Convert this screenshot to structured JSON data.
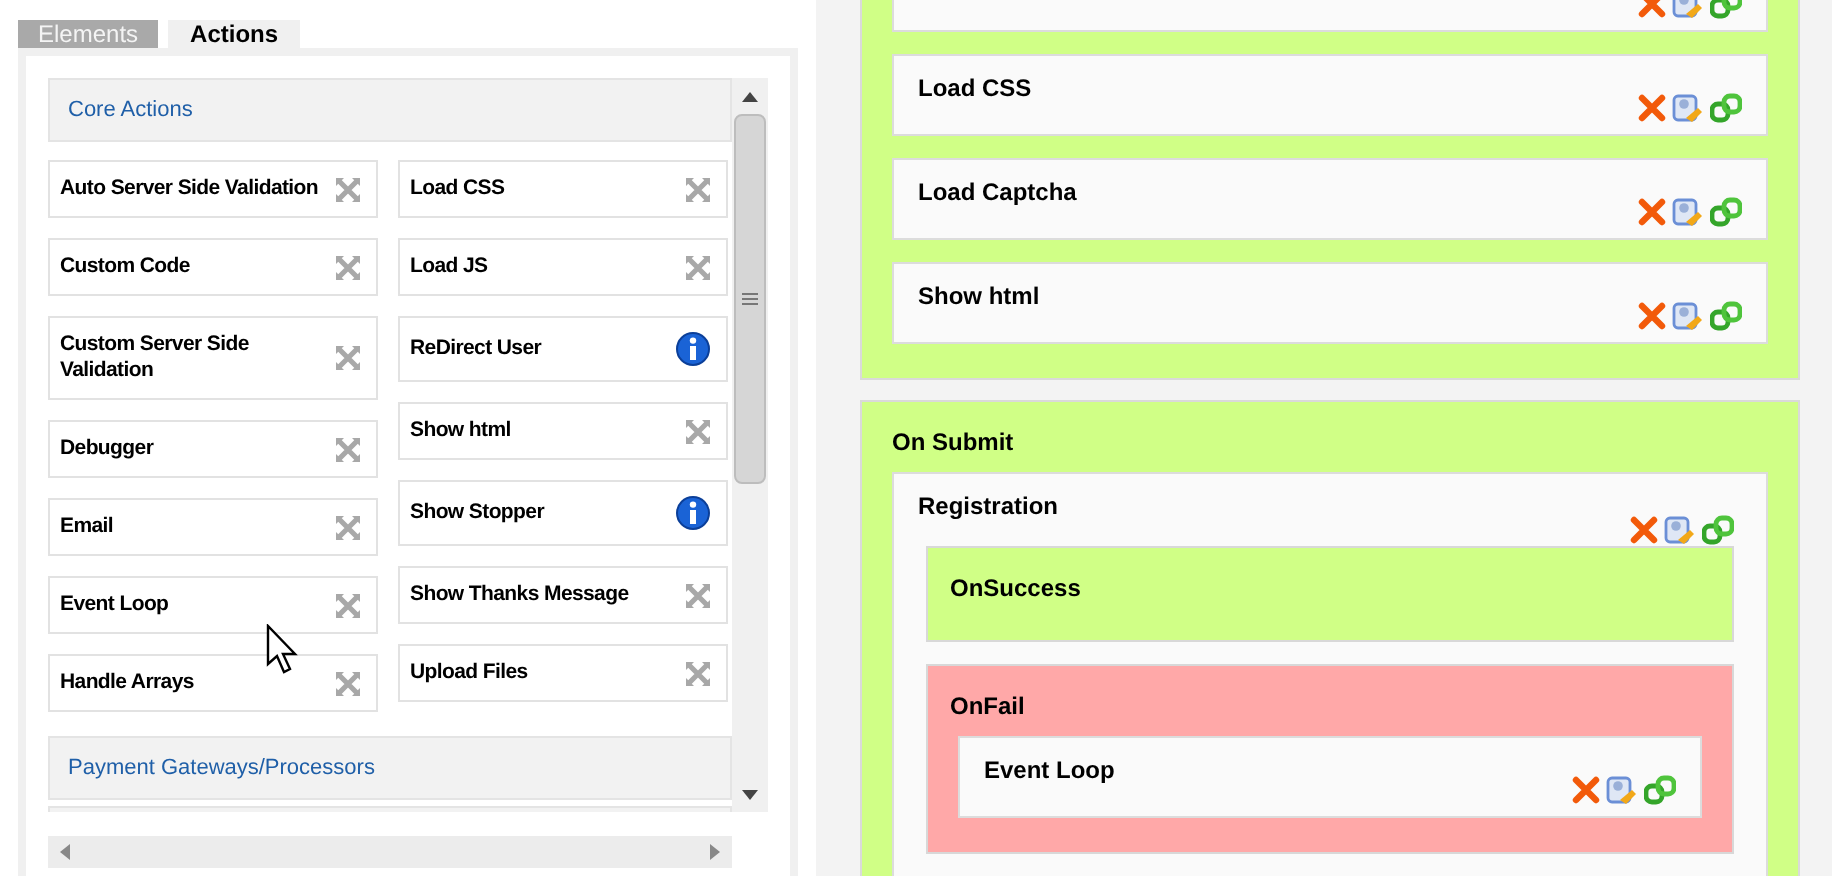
{
  "tabs": [
    {
      "label": "Elements",
      "selected": false
    },
    {
      "label": "Actions",
      "selected": true
    }
  ],
  "categories": [
    {
      "title": "Core Actions",
      "columns": [
        {
          "items": [
            {
              "label": "Auto Server Side Validation",
              "kind": "move"
            },
            {
              "label": "Custom Code",
              "kind": "move"
            },
            {
              "label": "Custom Server Side Validation",
              "kind": "move"
            },
            {
              "label": "Debugger",
              "kind": "move"
            },
            {
              "label": "Email",
              "kind": "move"
            },
            {
              "label": "Event Loop",
              "kind": "move"
            },
            {
              "label": "Handle Arrays",
              "kind": "move"
            }
          ]
        },
        {
          "items": [
            {
              "label": "Load CSS",
              "kind": "move"
            },
            {
              "label": "Load JS",
              "kind": "move"
            },
            {
              "label": "ReDirect User",
              "kind": "info"
            },
            {
              "label": "Show html",
              "kind": "move"
            },
            {
              "label": "Show Stopper",
              "kind": "info"
            },
            {
              "label": "Show Thanks Message",
              "kind": "move"
            },
            {
              "label": "Upload Files",
              "kind": "move"
            }
          ]
        }
      ]
    },
    {
      "title": "Payment Gateways/Processors"
    }
  ],
  "events": [
    {
      "actions": [
        {
          "kind": "action"
        },
        {
          "kind": "action",
          "label": "Load CSS"
        },
        {
          "kind": "action",
          "label": "Load Captcha"
        },
        {
          "kind": "action",
          "label": "Show html"
        }
      ]
    },
    {
      "title": "On Submit",
      "actions": [
        {
          "kind": "group",
          "label": "Registration",
          "branches": [
            {
              "label": "OnSuccess",
              "kind": "success"
            },
            {
              "label": "OnFail",
              "kind": "fail",
              "actions": [
                {
                  "kind": "action",
                  "label": "Event Loop"
                }
              ]
            }
          ]
        }
      ]
    }
  ]
}
